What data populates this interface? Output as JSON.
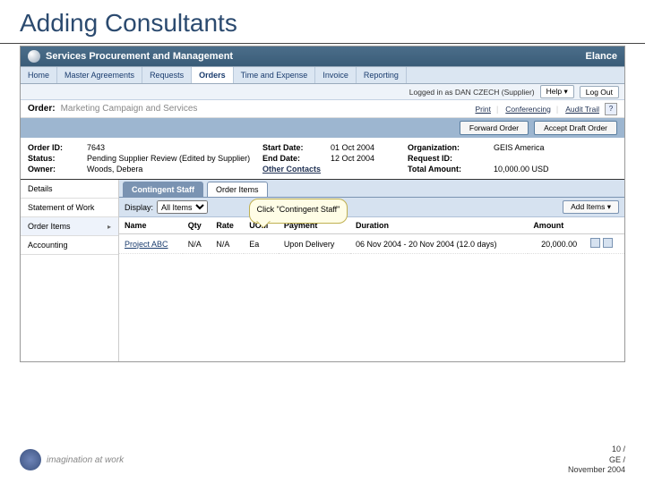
{
  "slide": {
    "title": "Adding Consultants"
  },
  "header": {
    "app_title": "Services Procurement and Management",
    "brand": "Elance"
  },
  "nav": {
    "items": [
      {
        "label": "Home"
      },
      {
        "label": "Master Agreements"
      },
      {
        "label": "Requests"
      },
      {
        "label": "Orders"
      },
      {
        "label": "Time and Expense"
      },
      {
        "label": "Invoice"
      },
      {
        "label": "Reporting"
      }
    ],
    "active_index": 3
  },
  "util": {
    "login_text": "Logged in as DAN CZECH (Supplier)",
    "help_label": "Help",
    "logout_label": "Log Out"
  },
  "order_header": {
    "label": "Order:",
    "name": "Marketing Campaign and Services",
    "links": {
      "print": "Print",
      "conferencing": "Conferencing",
      "audit": "Audit Trail"
    },
    "help_icon": "?"
  },
  "action_bar": {
    "forward_label": "Forward Order",
    "accept_label": "Accept Draft Order"
  },
  "meta": {
    "rows": [
      {
        "l1": "Order ID:",
        "v1": "7643",
        "l2": "Start Date:",
        "v2": "01 Oct 2004",
        "l3": "Organization:",
        "v3": "GEIS America"
      },
      {
        "l1": "Status:",
        "v1": "Pending Supplier Review (Edited by Supplier)",
        "l2": "End Date:",
        "v2": "12 Oct 2004",
        "l3": "Request ID:",
        "v3": ""
      },
      {
        "l1": "Owner:",
        "v1": "Woods, Debera",
        "l2": "Other Contacts",
        "v2": "",
        "l3": "Total Amount:",
        "v3": "10,000.00 USD"
      }
    ]
  },
  "sidenav": {
    "items": [
      {
        "label": "Details"
      },
      {
        "label": "Statement of Work"
      },
      {
        "label": "Order Items",
        "active": true
      },
      {
        "label": "Accounting"
      }
    ]
  },
  "subtabs": {
    "items": [
      {
        "label": "Contingent Staff",
        "active": true
      },
      {
        "label": "Order Items"
      }
    ]
  },
  "toolbar2": {
    "display_label": "Display:",
    "select_value": "All Items",
    "add_item_label": "Add Items"
  },
  "table": {
    "columns": [
      "Name",
      "Qty",
      "Rate",
      "UOM",
      "Payment",
      "Duration",
      "Amount"
    ],
    "rows": [
      {
        "name": "Project ABC",
        "qty": "N/A",
        "rate": "N/A",
        "uom": "Ea",
        "payment": "Upon Delivery",
        "duration": "06 Nov 2004 - 20 Nov 2004 (12.0 days)",
        "amount": "20,000.00"
      }
    ]
  },
  "callout": {
    "text": "Click \"Contingent Staff\""
  },
  "footer": {
    "tagline": "imagination at work",
    "page": "10 /",
    "org": "GE /",
    "date": "November 2004"
  }
}
